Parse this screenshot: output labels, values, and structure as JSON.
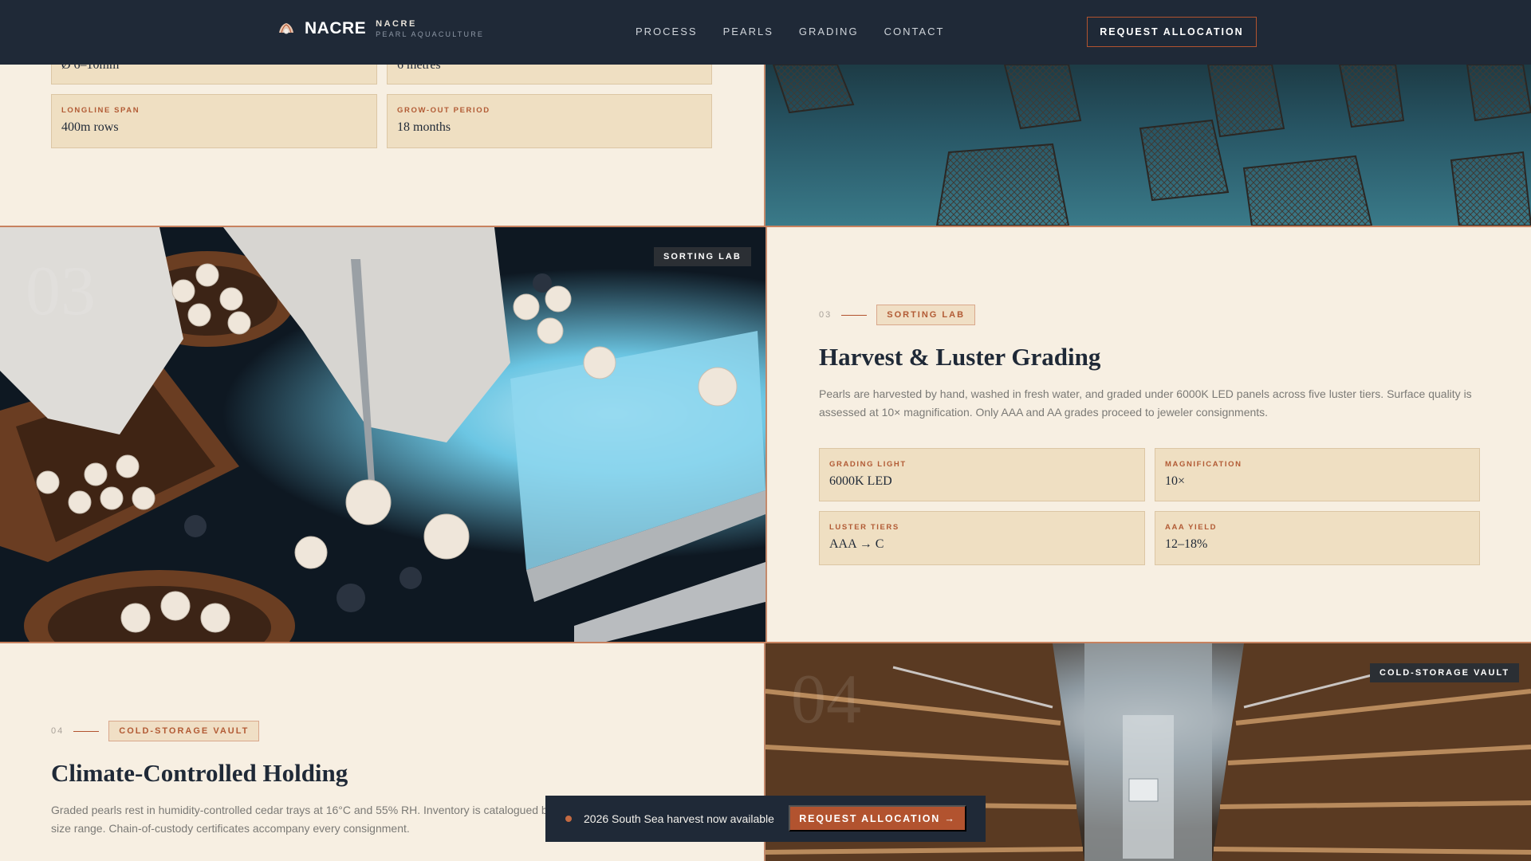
{
  "header": {
    "brand_name": "NACRE",
    "brand_sub1": "NACRE",
    "brand_sub2": "PEARL AQUACULTURE",
    "nav": [
      "PROCESS",
      "PEARLS",
      "GRADING",
      "CONTACT"
    ],
    "cta": "REQUEST ALLOCATION",
    "brand_icon": "pearl-shell-icon"
  },
  "section_02": {
    "cards": [
      {
        "label": "",
        "value": "Ø 6–10mm"
      },
      {
        "label": "",
        "value": "6 metres"
      },
      {
        "label": "LONGLINE SPAN",
        "value": "400m rows"
      },
      {
        "label": "GROW-OUT PERIOD",
        "value": "18 months"
      }
    ]
  },
  "section_03": {
    "image_badge": "SORTING LAB",
    "image_number": "03",
    "eyebrow_num": "03",
    "eyebrow_tag": "SORTING LAB",
    "title": "Harvest & Luster Grading",
    "paragraph": "Pearls are harvested by hand, washed in fresh water, and graded under 6000K LED panels across five luster tiers. Surface quality is assessed at 10× magnification. Only AAA and AA grades proceed to jeweler consignments.",
    "cards": [
      {
        "label": "GRADING LIGHT",
        "value": "6000K LED"
      },
      {
        "label": "MAGNIFICATION",
        "value": "10×"
      },
      {
        "label": "LUSTER TIERS",
        "value": "AAA → C"
      },
      {
        "label": "AAA YIELD",
        "value": "12–18%"
      }
    ]
  },
  "section_04": {
    "eyebrow_num": "04",
    "eyebrow_tag": "COLD-STORAGE VAULT",
    "title": "Climate-Controlled Holding",
    "paragraph_line1": "Graded pearls rest in humidity-controlled cedar trays at 16°C and 55% RH. Inventory is catalogued b",
    "paragraph_line2": "size range. Chain-of-custody certificates accompany every consignment.",
    "image_badge": "COLD-STORAGE VAULT",
    "image_number": "04"
  },
  "float_bar": {
    "text": "2026 South Sea harvest now available",
    "button": "REQUEST ALLOCATION →"
  },
  "colors": {
    "accent": "#b2532f",
    "navy": "#1f2937",
    "cream": "#f7efe2",
    "card": "#efdfc2"
  }
}
